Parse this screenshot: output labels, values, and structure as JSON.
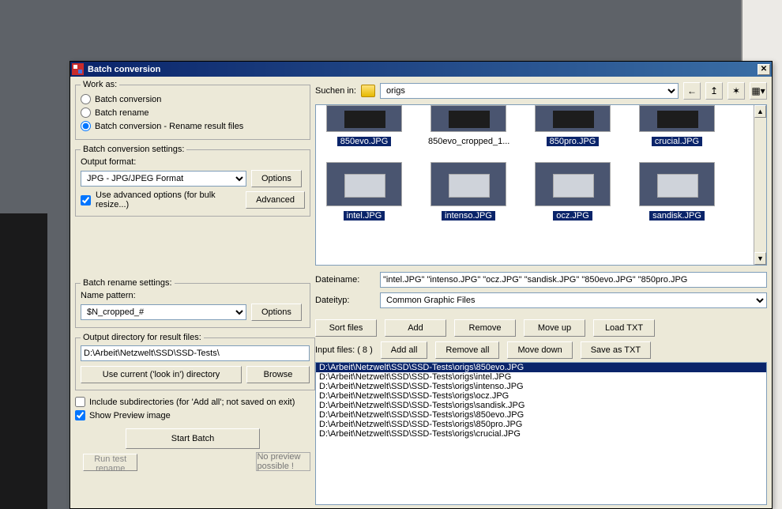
{
  "title": "Batch conversion",
  "workAs": {
    "legend": "Work as:",
    "opt1": "Batch conversion",
    "opt2": "Batch rename",
    "opt3": "Batch conversion - Rename result files"
  },
  "convSettings": {
    "legend": "Batch conversion settings:",
    "outputFormatLbl": "Output format:",
    "outputFormat": "JPG - JPG/JPEG Format",
    "optionsBtn": "Options",
    "advancedChk": "Use advanced options (for bulk resize...)",
    "advancedBtn": "Advanced"
  },
  "renameSettings": {
    "legend": "Batch rename settings:",
    "namePatternLbl": "Name pattern:",
    "namePattern": "$N_cropped_#",
    "optionsBtn": "Options"
  },
  "outputDir": {
    "legend": "Output directory for result files:",
    "path": "D:\\Arbeit\\Netzwelt\\SSD\\SSD-Tests\\",
    "useCurrentBtn": "Use current ('look in') directory",
    "browseBtn": "Browse"
  },
  "includeSubdirs": "Include subdirectories (for 'Add all'; not saved on exit)",
  "showPreview": "Show Preview image",
  "startBatch": "Start Batch",
  "runTestRename": "Run test rename",
  "previewMsg": "No preview possible !",
  "browser": {
    "lookInLbl": "Suchen in:",
    "folder": "origs",
    "files": [
      {
        "name": "850evo.JPG",
        "selected": true,
        "row": 0
      },
      {
        "name": "850evo_cropped_1...",
        "selected": false,
        "row": 0
      },
      {
        "name": "850pro.JPG",
        "selected": true,
        "row": 0
      },
      {
        "name": "crucial.JPG",
        "selected": true,
        "row": 0
      },
      {
        "name": "intel.JPG",
        "selected": true,
        "row": 1
      },
      {
        "name": "intenso.JPG",
        "selected": true,
        "row": 1
      },
      {
        "name": "ocz.JPG",
        "selected": true,
        "row": 1
      },
      {
        "name": "sandisk.JPG",
        "selected": true,
        "row": 1
      }
    ],
    "dateinameLbl": "Dateiname:",
    "dateiname": "\"intel.JPG\" \"intenso.JPG\" \"ocz.JPG\" \"sandisk.JPG\" \"850evo.JPG\" \"850pro.JPG",
    "dateitypLbl": "Dateityp:",
    "dateityp": "Common Graphic Files"
  },
  "buttons": {
    "sort": "Sort files",
    "add": "Add",
    "remove": "Remove",
    "moveUp": "Move up",
    "loadTxt": "Load TXT",
    "addAll": "Add all",
    "removeAll": "Remove all",
    "moveDown": "Move down",
    "saveTxt": "Save as TXT"
  },
  "inputFilesLbl": "Input files: ( 8 )",
  "inputFiles": [
    "D:\\Arbeit\\Netzwelt\\SSD\\SSD-Tests\\origs\\850evo.JPG",
    "D:\\Arbeit\\Netzwelt\\SSD\\SSD-Tests\\origs\\intel.JPG",
    "D:\\Arbeit\\Netzwelt\\SSD\\SSD-Tests\\origs\\intenso.JPG",
    "D:\\Arbeit\\Netzwelt\\SSD\\SSD-Tests\\origs\\ocz.JPG",
    "D:\\Arbeit\\Netzwelt\\SSD\\SSD-Tests\\origs\\sandisk.JPG",
    "D:\\Arbeit\\Netzwelt\\SSD\\SSD-Tests\\origs\\850evo.JPG",
    "D:\\Arbeit\\Netzwelt\\SSD\\SSD-Tests\\origs\\850pro.JPG",
    "D:\\Arbeit\\Netzwelt\\SSD\\SSD-Tests\\origs\\crucial.JPG"
  ]
}
